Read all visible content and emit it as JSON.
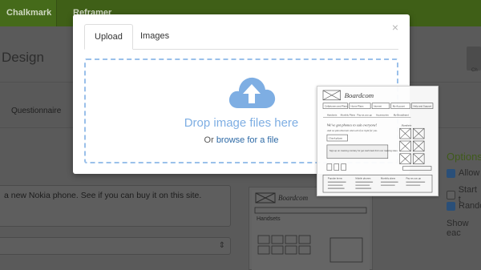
{
  "topnav": {
    "tabs": [
      "Chalkmark",
      "Reframer"
    ]
  },
  "page": {
    "heading": "Design",
    "right_icon_label": "Ch"
  },
  "subnav": {
    "tab": "Questionnaire"
  },
  "task": {
    "text": "a new Nokia phone. See if you can buy it on this site."
  },
  "options": {
    "title": "Options",
    "items": [
      {
        "label": "Allow",
        "checked": true
      },
      {
        "label": "Start t",
        "checked": false
      },
      {
        "label": "Rando",
        "checked": true
      },
      {
        "label": "Show eac",
        "checked": null
      }
    ]
  },
  "modal": {
    "tabs": [
      "Upload",
      "Images"
    ],
    "active_tab": "Upload",
    "close_glyph": "×",
    "drop_text": "Drop image files here",
    "or_text": "Or",
    "browse_link": "browse for a file"
  },
  "sketch": {
    "brand": "Boardcom",
    "nav": [
      "Cellphones and Plans",
      "Home Plans",
      "Internet",
      "My Account",
      "Help and Support"
    ],
    "subnav": [
      "Handsets",
      "Monthly Plans",
      "Pay as you go",
      "Accessories",
      "My Broadband"
    ],
    "headline": "We've got phones to suit everyone!",
    "subline": "And we plan discount when all of us right for you.",
    "check_plans": "Check plans",
    "promo": "Sign up on roaming contrary for get cash back from our roaming rates",
    "col_title": "Handsets",
    "footer": [
      "Popular items",
      "Mobile phones",
      "Monthly plans",
      "Pay as you go"
    ]
  }
}
